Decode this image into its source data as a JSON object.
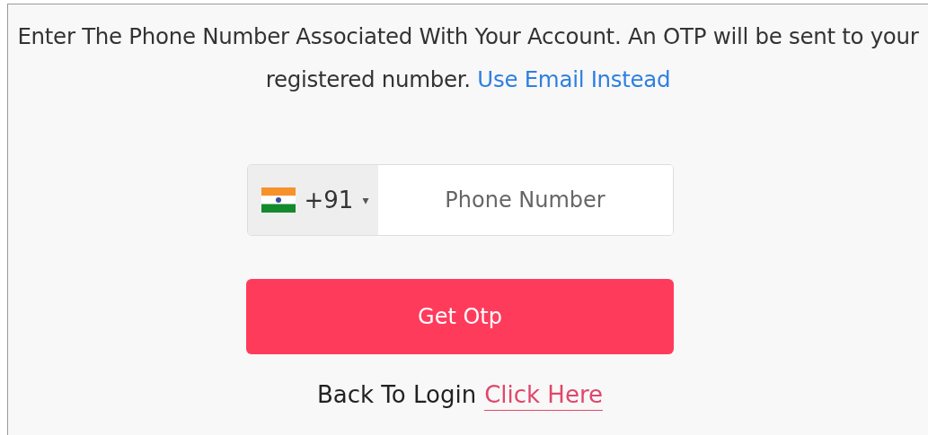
{
  "instructions": {
    "text": "Enter The Phone Number Associated With Your Account. An OTP will be sent to your registered number.",
    "link": "Use Email Instead"
  },
  "phone_field": {
    "country_code": "+91",
    "caret": "▾",
    "placeholder": "Phone Number"
  },
  "submit_button": {
    "label": "Get Otp"
  },
  "footer": {
    "text": "Back To Login",
    "link": "Click Here"
  }
}
